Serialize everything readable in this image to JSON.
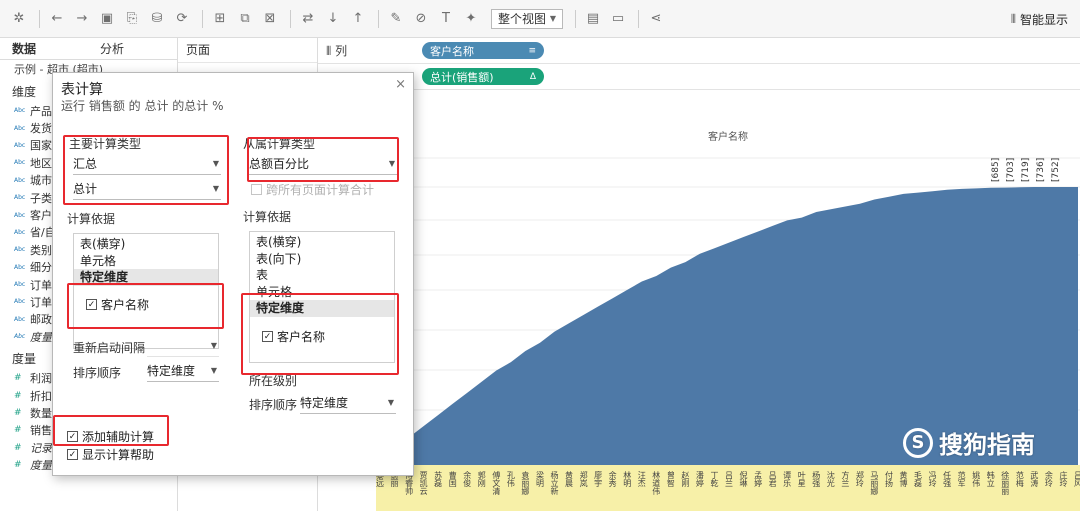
{
  "toolbar": {
    "view_select": "整个视图",
    "smart_label": "智能显示"
  },
  "left_panel": {
    "tab_data": "数据",
    "tab_analysis": "分析",
    "source": "示例 - 超市 (超市)",
    "dimensions_label": "维度",
    "dimensions": [
      "产品",
      "发货",
      "国家",
      "地区",
      "城市",
      "子类",
      "客户",
      "省/自",
      "类别",
      "细分",
      "订单",
      "订单",
      "邮政",
      "度量"
    ],
    "measures_label": "度量",
    "measures": [
      "利润",
      "折扣",
      "数量",
      "销售",
      "记录",
      "度量"
    ]
  },
  "pages_label": "页面",
  "shelves": {
    "columns_label": "列",
    "columns_pill": "客户名称",
    "rows_pill": "总计(销售额)"
  },
  "chart_data": {
    "type": "area",
    "header": "客户名称",
    "top_labels": [
      "[685]",
      "[703]",
      "[719]",
      "[736]",
      "[752]"
    ],
    "x_labels": [
      "黎远",
      "俞丽",
      "傅睿帅",
      "贾凯云",
      "苏磊",
      "曹国",
      "余俊",
      "郭刚",
      "傅文清",
      "孔伟",
      "袁丽娜",
      "梁明",
      "杨立新",
      "黄晨",
      "郑岚",
      "廖宇",
      "余秀",
      "林明",
      "汪杰",
      "林道伟",
      "曾智",
      "赵刚",
      "潘婷",
      "丁乾",
      "吕兰",
      "倪琳",
      "孟婷",
      "吕君",
      "谭乐",
      "叶星",
      "杨强",
      "沈光",
      "方兰",
      "郑玲",
      "马丽娜",
      "付扬",
      "黄博",
      "毛磊",
      "冯玲",
      "任强",
      "范军",
      "姚伟",
      "韩立",
      "徐丽丽",
      "范梅",
      "武涛",
      "余玲",
      "庄玲",
      "吕风"
    ],
    "series": [
      {
        "values": [
          0.02,
          0.06,
          0.1,
          0.14,
          0.18,
          0.22,
          0.26,
          0.3,
          0.34,
          0.37,
          0.41,
          0.44,
          0.48,
          0.51,
          0.54,
          0.57,
          0.6,
          0.63,
          0.66,
          0.68,
          0.71,
          0.73,
          0.76,
          0.78,
          0.8,
          0.82,
          0.84,
          0.86,
          0.88,
          0.89,
          0.91,
          0.92,
          0.93,
          0.94,
          0.955,
          0.965,
          0.975,
          0.98,
          0.985,
          0.99,
          0.993,
          0.995,
          0.997,
          0.998,
          0.999,
          1.0,
          1.0,
          1.0,
          1.0
        ]
      }
    ],
    "color": "#4e79a7",
    "ylim": [
      0,
      1
    ]
  },
  "dialog": {
    "title": "表计算",
    "subtitle": "运行 销售额 的 总计 的总计 %",
    "primary_type_label": "主要计算类型",
    "primary_type_value": "汇总",
    "primary_agg_value": "总计",
    "compute_using_label": "计算依据",
    "primary_list": [
      "表(横穿)",
      "单元格",
      "特定维度"
    ],
    "primary_list_selected": "特定维度",
    "primary_check_label": "客户名称",
    "restart_label": "重新启动间隔",
    "sort_label": "排序顺序",
    "sort_value": "特定维度",
    "secondary_type_label": "从属计算类型",
    "secondary_type_value": "总额百分比",
    "secondary_check_all_pages": "跨所有页面计算合计",
    "secondary_compute_label": "计算依据",
    "secondary_list": [
      "表(横穿)",
      "表(向下)",
      "表",
      "单元格",
      "特定维度"
    ],
    "secondary_list_selected": "特定维度",
    "secondary_check_label": "客户名称",
    "secondary_level_label": "所在级别",
    "secondary_sort_label": "排序顺序",
    "secondary_sort_value": "特定维度",
    "add_secondary_label": "添加辅助计算",
    "show_help_label": "显示计算帮助"
  },
  "watermark": "搜狗指南",
  "colors": {
    "accent_red": "#e8282e",
    "pill_blue": "#4b8ab3",
    "pill_green": "#1aa37a",
    "area_blue": "#4e79a7",
    "label_yellow": "#f7f0a8"
  }
}
